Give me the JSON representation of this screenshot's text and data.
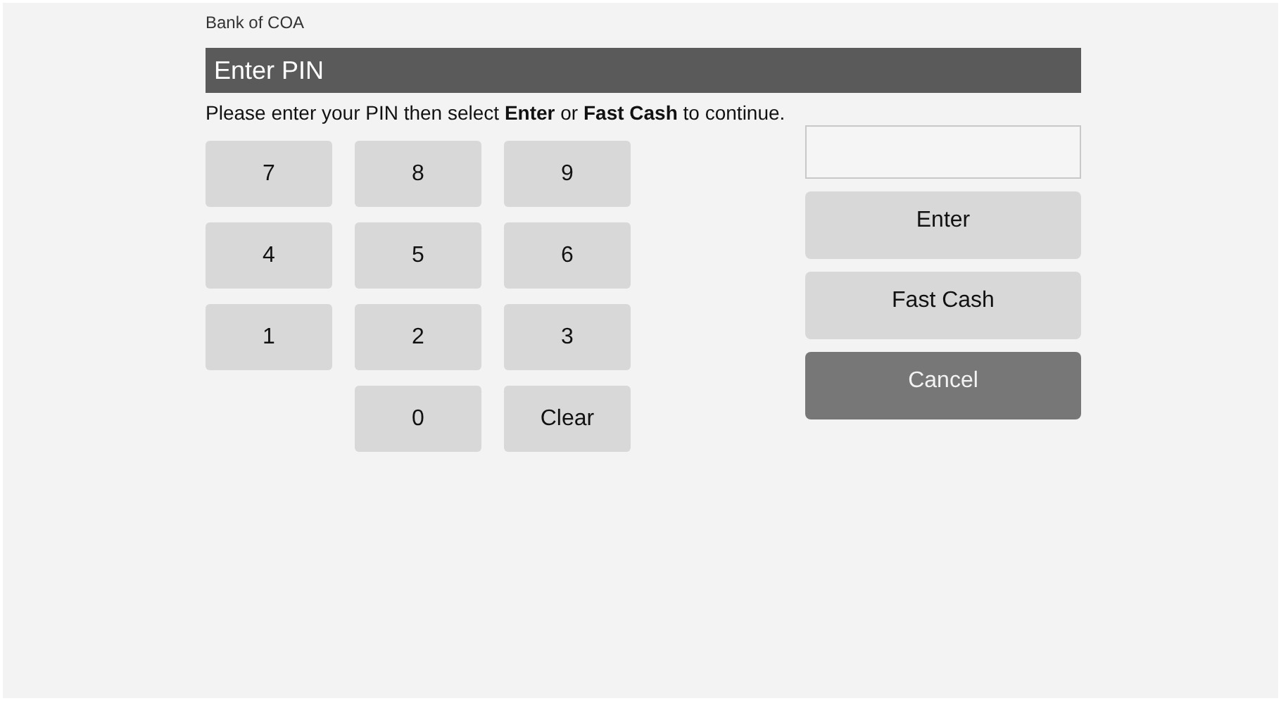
{
  "bank_name": "Bank of COA",
  "title": "Enter PIN",
  "instruction": "Please enter your PIN then select **Enter** or **Fast Cash** to continue.",
  "keypad_rows": [
    [
      "7",
      "8",
      "9"
    ],
    [
      "4",
      "5",
      "6"
    ],
    [
      "1",
      "2",
      "3"
    ],
    [
      "0",
      "Clear"
    ]
  ],
  "actions": [
    {
      "label": "Enter",
      "kind": "primary"
    },
    {
      "label": "Fast Cash",
      "kind": "primary"
    },
    {
      "label": "Cancel",
      "kind": "cancel"
    }
  ]
}
